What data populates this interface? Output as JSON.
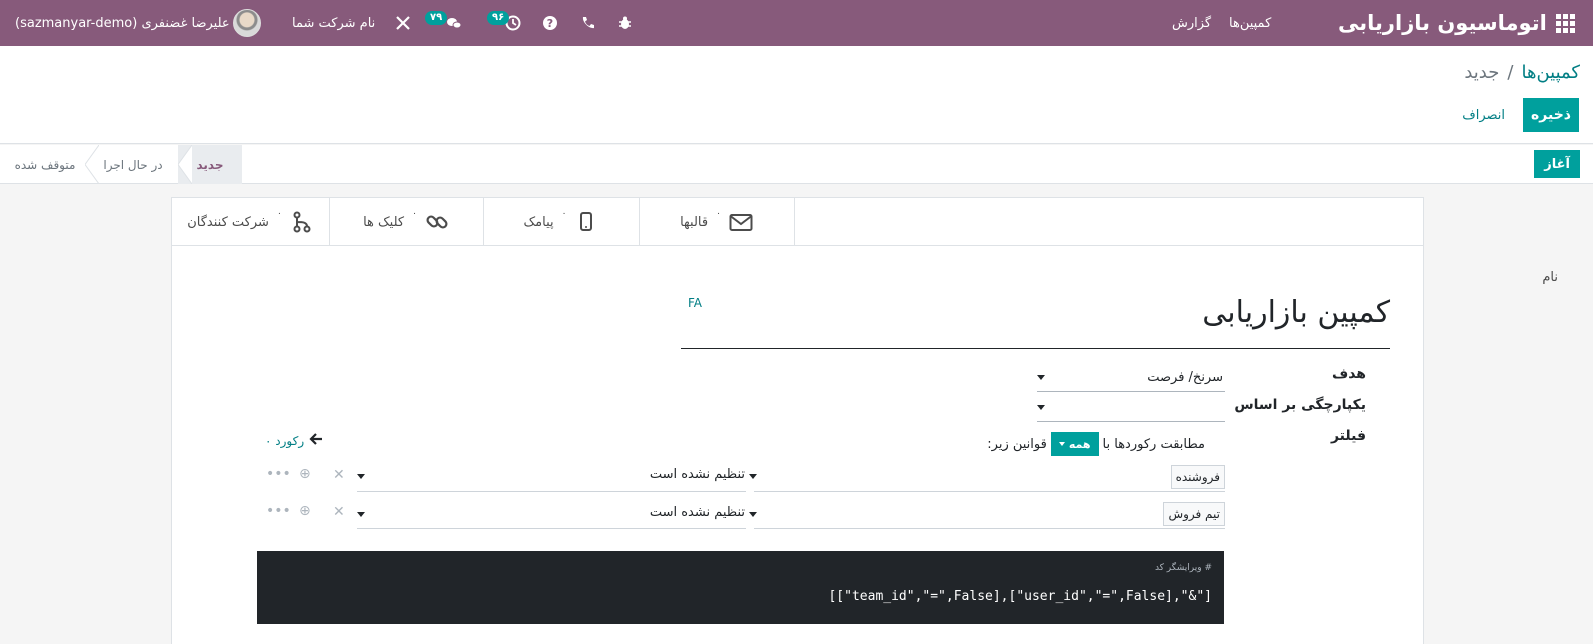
{
  "navbar": {
    "app_title": "اتوماسیون بازاریابی",
    "menu_campaigns": "کمپین‌ها",
    "menu_report": "گزارش",
    "badge_activities": "۹۶",
    "badge_messages": "۷۹",
    "company_name": "نام شرکت شما",
    "user_name": "علیرضا غضنفری (sazmanyar-demo)"
  },
  "breadcrumb": {
    "parent": "کمپین‌ها",
    "separator": "/",
    "current": "جدید"
  },
  "actions": {
    "save": "ذخیره",
    "discard": "انصراف",
    "start": "آغاز"
  },
  "stages": {
    "new": "جدید",
    "running": "در حال اجرا",
    "stopped": "متوقف شده"
  },
  "stat_buttons": [
    {
      "label": "شرکت کنندگان",
      "count": "۰",
      "icon": "participants-icon"
    },
    {
      "label": "کلیک ها",
      "count": "۰",
      "icon": "link-icon"
    },
    {
      "label": "پیامک",
      "count": "۰",
      "icon": "mobile-icon"
    },
    {
      "label": "قالبها",
      "count": "۰",
      "icon": "envelope-icon"
    }
  ],
  "form": {
    "name_label": "نام",
    "name_value": "کمپین بازاریابی",
    "lang_tag": "FA",
    "target_label": "هدف",
    "target_value": "سرنخ/ فرصت",
    "unicity_label": "یکپارچگی بر اساس",
    "unicity_value": "",
    "filter_label": "فیلتر"
  },
  "domain": {
    "match_prefix": "مطابقت رکوردها با",
    "match_button": "همه",
    "match_suffix": "قوانین زیر:",
    "records_count": "۰ رکورد",
    "rules": [
      {
        "field": "فروشنده",
        "operator": "تنظیم نشده است"
      },
      {
        "field": "تیم فروش",
        "operator": "تنظیم نشده است"
      }
    ],
    "code_editor_label": "# ویرایشگر کد",
    "code": "[[\"team_id\",\"=\",False],[\"user_id\",\"=\",False],\"&\"]"
  }
}
